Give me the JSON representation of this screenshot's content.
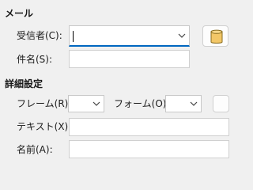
{
  "mail": {
    "section_title": "メール",
    "to_label": "受信者(C):",
    "to_value": "",
    "subject_label": "件名(S):",
    "subject_value": "",
    "address_book_icon": "address-book-icon"
  },
  "advanced": {
    "section_title": "詳細設定",
    "frame_label": "フレーム(R):",
    "frame_value": "",
    "form_label": "フォーム(O):",
    "form_value": "",
    "text_label": "テキスト(X):",
    "text_value": "",
    "name_label": "名前(A):",
    "name_value": ""
  },
  "colors": {
    "focus_accent": "#0067c0",
    "address_book_icon": "#f3c767"
  }
}
